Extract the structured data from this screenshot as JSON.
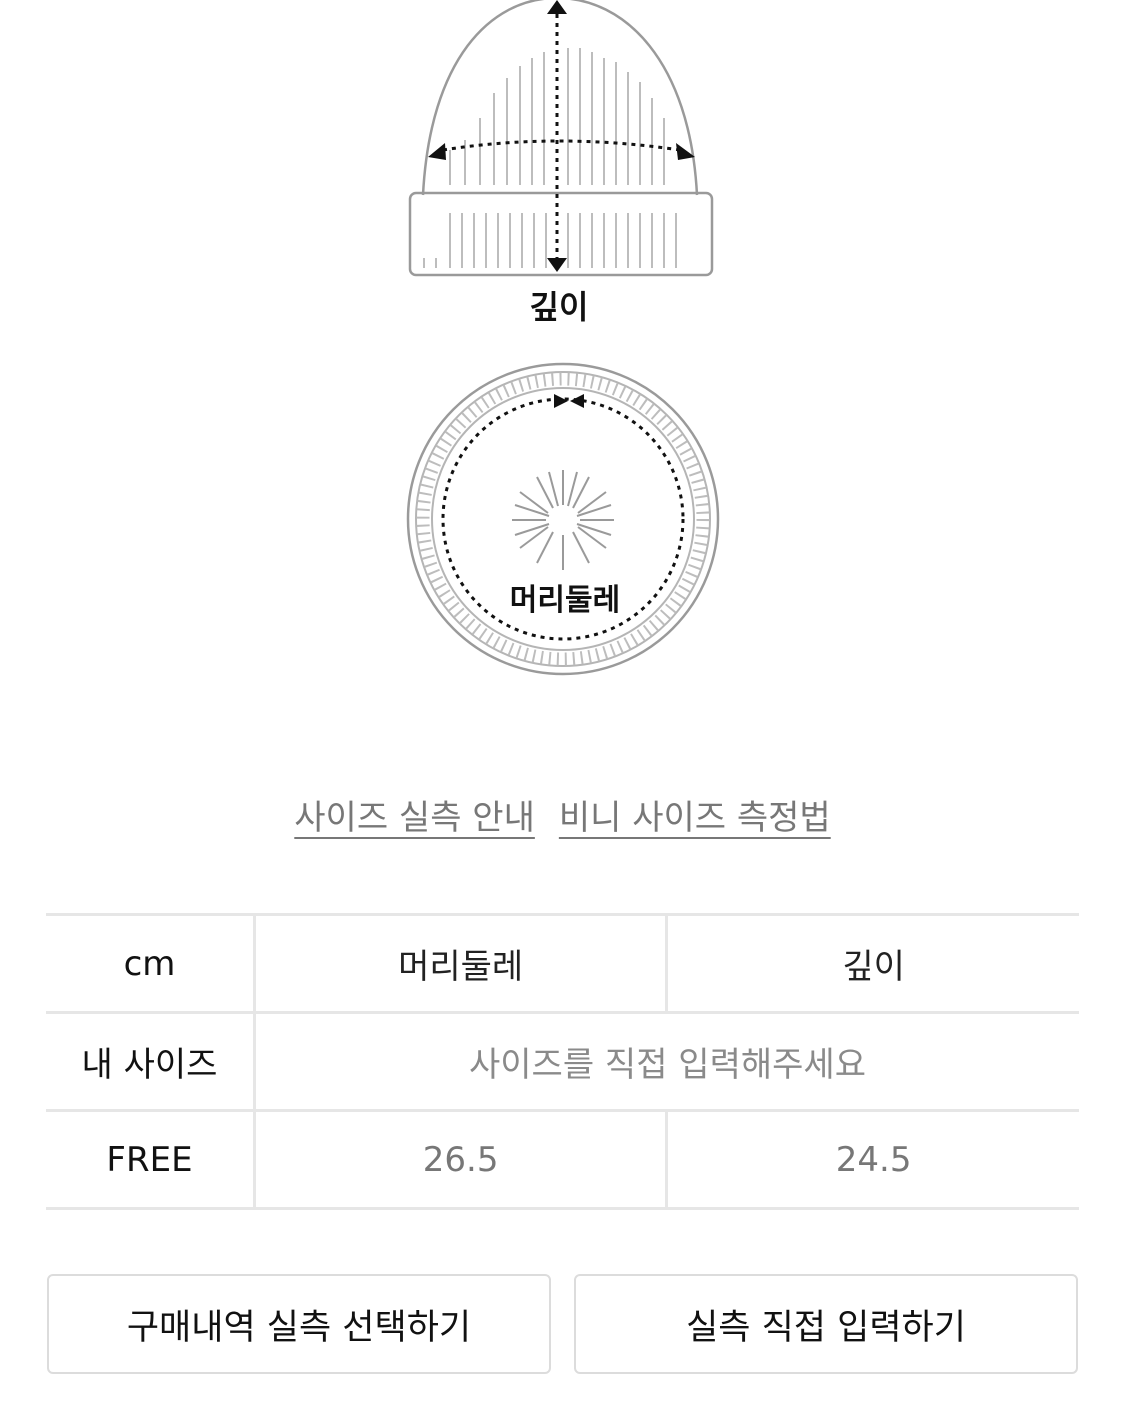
{
  "diagram": {
    "depth_label": "깊이",
    "circumference_label": "머리둘레"
  },
  "links": {
    "size_guide": "사이즈 실측 안내",
    "measure_method": "비니 사이즈 측정법"
  },
  "table": {
    "header": [
      "cm",
      "머리둘레",
      "깊이"
    ],
    "my_size_label": "내 사이즈",
    "my_size_placeholder": "사이즈를 직접 입력해주세요",
    "rows": [
      {
        "size": "FREE",
        "circumference": "26.5",
        "depth": "24.5"
      }
    ]
  },
  "buttons": {
    "select_history": "구매내역 실측 선택하기",
    "enter_manually": "실측 직접 입력하기"
  }
}
